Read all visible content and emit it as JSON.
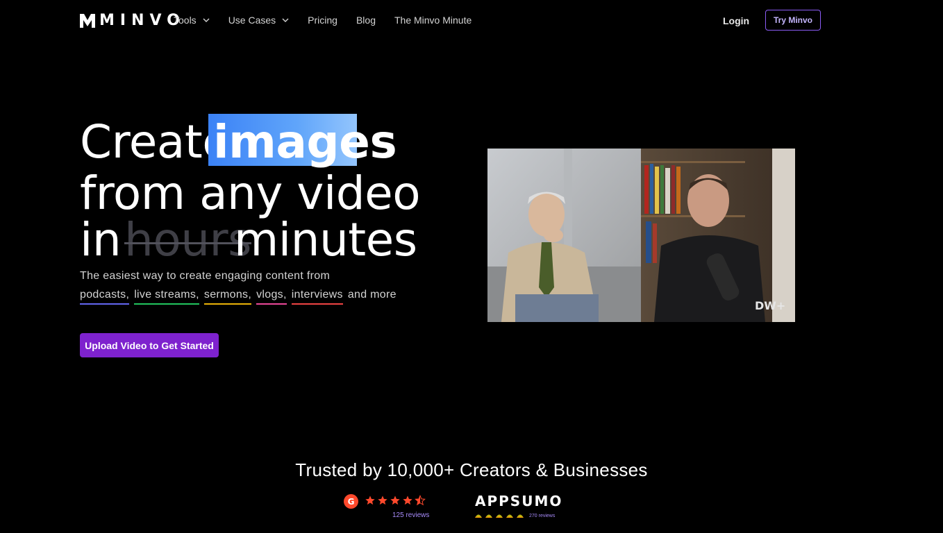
{
  "nav": {
    "logo_text": "MINVO",
    "links": [
      {
        "label": "Tools",
        "has_dropdown": true
      },
      {
        "label": "Use Cases",
        "has_dropdown": true
      },
      {
        "label": "Pricing",
        "has_dropdown": false
      },
      {
        "label": "Blog",
        "has_dropdown": false
      },
      {
        "label": "The Minvo Minute",
        "has_dropdown": false
      }
    ],
    "login_label": "Login",
    "cta_label": "Try Minvo"
  },
  "hero": {
    "line1_word": "Create",
    "highlight_word": "images",
    "line2": "from any video",
    "line3_prefix": "in",
    "struck_word": "hours",
    "line3_suffix": "minutes",
    "subtitle": "The easiest way to create engaging content from",
    "tags": [
      {
        "label": "podcasts,",
        "underline_color": "#6366f1"
      },
      {
        "label": "live streams,",
        "underline_color": "#22c55e"
      },
      {
        "label": "sermons,",
        "underline_color": "#eab308"
      },
      {
        "label": "vlogs,",
        "underline_color": "#ec4899"
      },
      {
        "label": "interviews",
        "underline_color": "#ef4444"
      }
    ],
    "tags_suffix": "and more",
    "cta_label": "Upload Video to Get Started",
    "highlight_color": "#60a5fa"
  },
  "video": {
    "watermark": "DW+"
  },
  "trust": {
    "heading": "Trusted by 10,000+ Creators & Businesses",
    "g2": {
      "rating_stars": 4.5,
      "reviews_label": "125 reviews"
    },
    "appsumo": {
      "wordmark": "APPSUMO",
      "rating_tacos": 5,
      "reviews_label": "270 reviews"
    }
  },
  "colors": {
    "accent_purple": "#7e22ce",
    "border_purple": "#8b5cf6",
    "star_orange": "#ff492c",
    "taco_yellow": "#f59e0b"
  }
}
